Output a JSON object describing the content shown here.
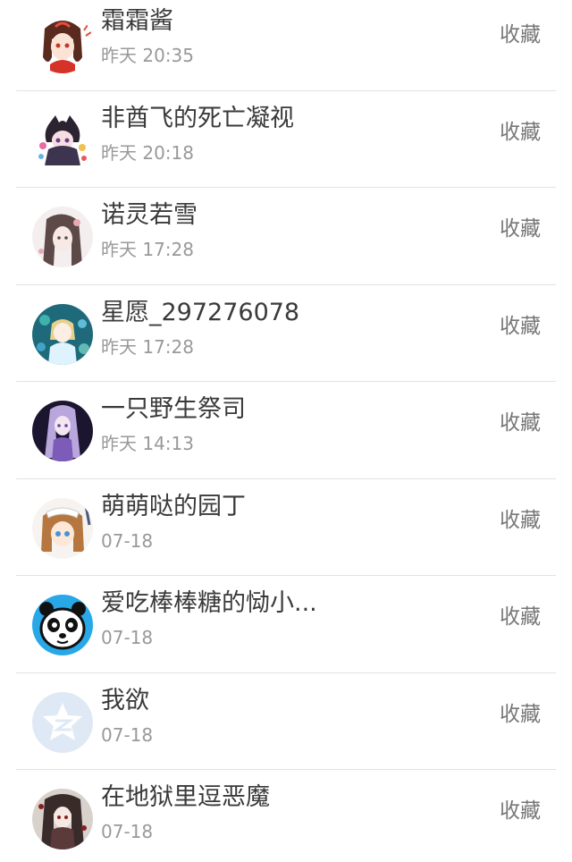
{
  "contacts": [
    {
      "name": "霜霜酱",
      "time": "昨天 20:35",
      "action": "收藏",
      "avatar": "anime-girl-red-avatar"
    },
    {
      "name": "非酋飞的死亡凝视",
      "time": "昨天 20:18",
      "action": "收藏",
      "avatar": "anime-chibi-dark-avatar"
    },
    {
      "name": "诺灵若雪",
      "time": "昨天 17:28",
      "action": "收藏",
      "avatar": "anime-girl-sketch-avatar"
    },
    {
      "name": "星愿_297276078",
      "time": "昨天 17:28",
      "action": "收藏",
      "avatar": "anime-girl-blue-avatar"
    },
    {
      "name": "一只野生祭司",
      "time": "昨天 14:13",
      "action": "收藏",
      "avatar": "anime-girl-purple-avatar"
    },
    {
      "name": "萌萌哒的园丁",
      "time": "07-18",
      "action": "收藏",
      "avatar": "anime-girl-brown-avatar"
    },
    {
      "name": "爱吃棒棒糖的恸小...",
      "time": "07-18",
      "action": "收藏",
      "avatar": "panda-icon"
    },
    {
      "name": "我欲",
      "time": "07-18",
      "action": "收藏",
      "avatar": "qzone-icon"
    },
    {
      "name": "在地狱里逗恶魔",
      "time": "07-18",
      "action": "收藏",
      "avatar": "anime-gothic-avatar"
    }
  ],
  "colors": {
    "name_text": "#3a3a3a",
    "time_text": "#999999",
    "action_text": "#777777",
    "divider": "#e3e3e3",
    "panda_bg": "#29a8e8",
    "qzone_bg": "#dfe9f5"
  }
}
